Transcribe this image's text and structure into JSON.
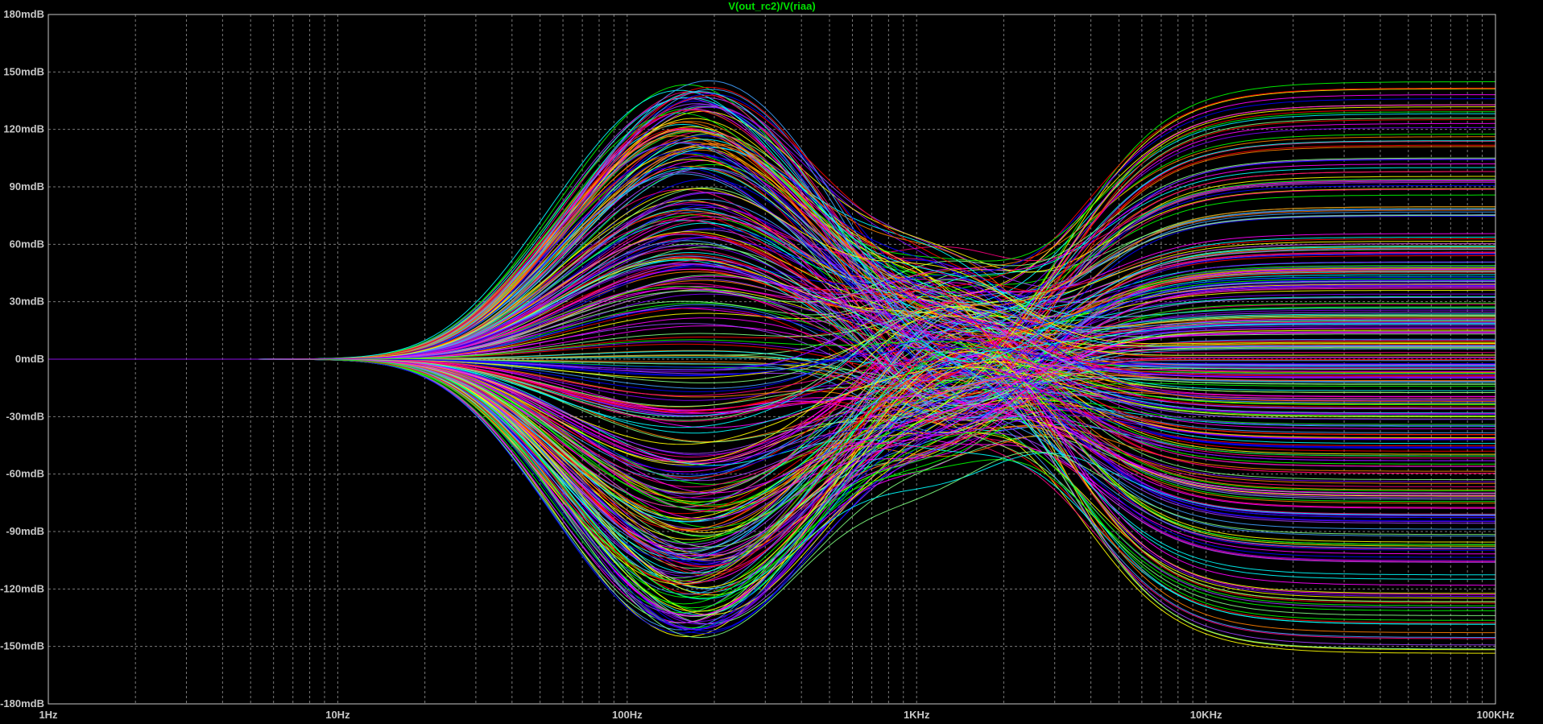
{
  "chart_data": {
    "type": "line",
    "title": "V(out_rc2)/V(riaa)",
    "title_color": "#00e000",
    "background": "#000000",
    "grid": true,
    "grid_color": "#7a7a7a",
    "x_scale": "log",
    "xlim": [
      1,
      100000
    ],
    "x_unit": "Hz",
    "ylim": [
      -180,
      180
    ],
    "y_unit": "dB",
    "x_ticks": [
      {
        "value": 1,
        "label": "1Hz"
      },
      {
        "value": 10,
        "label": "10Hz"
      },
      {
        "value": 100,
        "label": "100Hz"
      },
      {
        "value": 1000,
        "label": "1KHz"
      },
      {
        "value": 10000,
        "label": "10KHz"
      },
      {
        "value": 100000,
        "label": "100KHz"
      }
    ],
    "y_ticks": [
      {
        "value": 180,
        "label": "180mdB"
      },
      {
        "value": 150,
        "label": "150mdB"
      },
      {
        "value": 120,
        "label": "120mdB"
      },
      {
        "value": 90,
        "label": "90mdB"
      },
      {
        "value": 60,
        "label": "60mdB"
      },
      {
        "value": 30,
        "label": "30mdB"
      },
      {
        "value": 0,
        "label": "0mdB"
      },
      {
        "value": -30,
        "label": "-30mdB"
      },
      {
        "value": -60,
        "label": "-60mdB"
      },
      {
        "value": -90,
        "label": "-90mdB"
      },
      {
        "value": -120,
        "label": "-120mdB"
      },
      {
        "value": -150,
        "label": "-150mdB"
      },
      {
        "value": -180,
        "label": "-180mdB"
      }
    ],
    "series_colors": [
      "#ff00ff",
      "#00ff00",
      "#0000ff",
      "#ff0000",
      "#00ffff",
      "#ffff00",
      "#ff8000",
      "#8000ff",
      "#ff0080",
      "#80ff80",
      "#a040ff",
      "#40a0ff"
    ],
    "envelope": {
      "low_frequency_value": 0,
      "peak1": {
        "frequency": 170,
        "max": 146,
        "min": -138
      },
      "dip": {
        "frequency": 1300,
        "max": 68,
        "min": -58
      },
      "high_frequency_plateau": {
        "max": 169,
        "min": -169
      }
    },
    "series": []
  }
}
